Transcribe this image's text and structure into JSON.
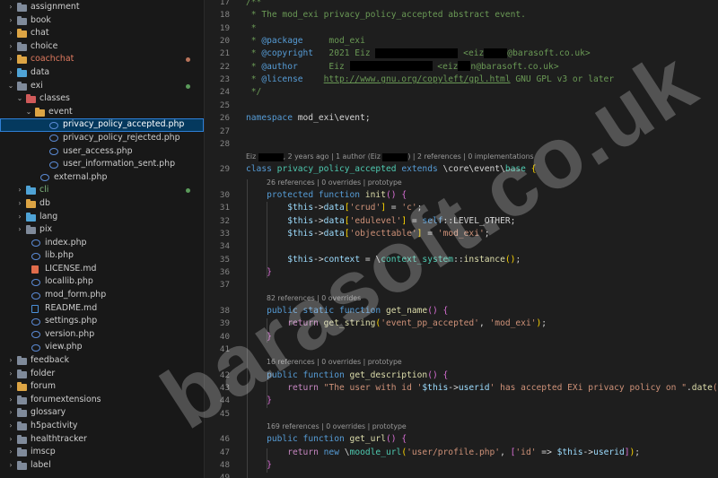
{
  "explorer": {
    "rows": [
      {
        "label": "assignment",
        "type": "folder",
        "chev": "›",
        "folder_color": "#7f8a9a"
      },
      {
        "label": "book",
        "type": "folder",
        "chev": "›",
        "folder_color": "#7f8a9a"
      },
      {
        "label": "chat",
        "type": "folder",
        "chev": "›",
        "folder_color": "#dca444"
      },
      {
        "label": "choice",
        "type": "folder",
        "chev": "›",
        "folder_color": "#7f8a9a"
      },
      {
        "label": "coachchat",
        "type": "folder",
        "chev": "›",
        "folder_color": "#dca444",
        "label_color": "#e07a5f",
        "dot": "#b8735a"
      },
      {
        "label": "data",
        "type": "folder",
        "chev": "›",
        "folder_color": "#4fa3d6"
      },
      {
        "label": "exi",
        "type": "folder",
        "chev": "⌄",
        "folder_color": "#7f8a9a",
        "dot": "#5a9a5a"
      },
      {
        "label": "classes",
        "type": "folder",
        "chev": "⌄",
        "folder_color": "#d05a5a"
      },
      {
        "label": "event",
        "type": "folder",
        "chev": "⌄",
        "folder_color": "#dca444"
      },
      {
        "label": "privacy_policy_accepted.php",
        "type": "php",
        "selected": true
      },
      {
        "label": "privacy_policy_rejected.php",
        "type": "php"
      },
      {
        "label": "user_access.php",
        "type": "php"
      },
      {
        "label": "user_information_sent.php",
        "type": "php"
      },
      {
        "label": "external.php",
        "type": "php"
      },
      {
        "label": "cli",
        "type": "folder",
        "chev": "›",
        "folder_color": "#4fa3d6",
        "label_color": "#7fb77e",
        "dot": "#5a9a5a"
      },
      {
        "label": "db",
        "type": "folder",
        "chev": "›",
        "folder_color": "#dca444"
      },
      {
        "label": "lang",
        "type": "folder",
        "chev": "›",
        "folder_color": "#4fa3d6"
      },
      {
        "label": "pix",
        "type": "folder",
        "chev": "›",
        "folder_color": "#7f8a9a"
      },
      {
        "label": "index.php",
        "type": "php"
      },
      {
        "label": "lib.php",
        "type": "php"
      },
      {
        "label": "LICENSE.md",
        "type": "lic"
      },
      {
        "label": "locallib.php",
        "type": "php"
      },
      {
        "label": "mod_form.php",
        "type": "php"
      },
      {
        "label": "README.md",
        "type": "md"
      },
      {
        "label": "settings.php",
        "type": "php"
      },
      {
        "label": "version.php",
        "type": "php"
      },
      {
        "label": "view.php",
        "type": "php"
      },
      {
        "label": "feedback",
        "type": "folder",
        "chev": "›",
        "folder_color": "#7f8a9a"
      },
      {
        "label": "folder",
        "type": "folder",
        "chev": "›",
        "folder_color": "#7f8a9a"
      },
      {
        "label": "forum",
        "type": "folder",
        "chev": "›",
        "folder_color": "#dca444"
      },
      {
        "label": "forumextensions",
        "type": "folder",
        "chev": "›",
        "folder_color": "#7f8a9a"
      },
      {
        "label": "glossary",
        "type": "folder",
        "chev": "›",
        "folder_color": "#7f8a9a"
      },
      {
        "label": "h5pactivity",
        "type": "folder",
        "chev": "›",
        "folder_color": "#7f8a9a"
      },
      {
        "label": "healthtracker",
        "type": "folder",
        "chev": "›",
        "folder_color": "#7f8a9a"
      },
      {
        "label": "imscp",
        "type": "folder",
        "chev": "›",
        "folder_color": "#7f8a9a"
      },
      {
        "label": "label",
        "type": "folder",
        "chev": "›",
        "folder_color": "#7f8a9a"
      }
    ]
  },
  "editor": {
    "lines": [
      {
        "n": "17",
        "segs": [
          {
            "t": "/**",
            "c": "c"
          }
        ]
      },
      {
        "n": "18",
        "segs": [
          {
            "t": " * The mod_exi privacy_policy_accepted abstract event.",
            "c": "c"
          }
        ]
      },
      {
        "n": "19",
        "segs": [
          {
            "t": " *",
            "c": "c"
          }
        ]
      },
      {
        "n": "20",
        "segs": [
          {
            "t": " * ",
            "c": "c"
          },
          {
            "t": "@package",
            "c": "k"
          },
          {
            "t": "     mod_exi",
            "c": "c"
          }
        ]
      },
      {
        "n": "21",
        "segs": [
          {
            "t": " * ",
            "c": "c"
          },
          {
            "t": "@copyright",
            "c": "k"
          },
          {
            "t": "   2021 Eiz ",
            "c": "c"
          },
          {
            "r": 92
          },
          {
            "t": " <eiz",
            "c": "c"
          },
          {
            "r": 26
          },
          {
            "t": "@barasoft.co.uk>",
            "c": "c"
          }
        ]
      },
      {
        "n": "22",
        "segs": [
          {
            "t": " * ",
            "c": "c"
          },
          {
            "t": "@author",
            "c": "k"
          },
          {
            "t": "      Eiz ",
            "c": "c"
          },
          {
            "r": 92
          },
          {
            "t": " <eiz",
            "c": "c"
          },
          {
            "r": 14
          },
          {
            "t": "n@barasoft.co.uk>",
            "c": "c"
          }
        ]
      },
      {
        "n": "23",
        "segs": [
          {
            "t": " * ",
            "c": "c"
          },
          {
            "t": "@license",
            "c": "k"
          },
          {
            "t": "    ",
            "c": "c"
          },
          {
            "t": "http://www.gnu.org/copyleft/gpl.html",
            "c": "u"
          },
          {
            "t": " GNU GPL v3 or later",
            "c": "c"
          }
        ]
      },
      {
        "n": "24",
        "segs": [
          {
            "t": " */",
            "c": "c"
          }
        ]
      },
      {
        "n": "25",
        "segs": []
      },
      {
        "n": "26",
        "segs": [
          {
            "t": "namespace",
            "c": "k"
          },
          {
            "t": " mod_exi\\event;",
            "c": "w"
          }
        ]
      },
      {
        "n": "27",
        "segs": []
      },
      {
        "n": "28",
        "segs": []
      },
      {
        "lens": [
          "Eiz ",
          {
            "r": 28
          },
          ", 2 years ago | 1 author (Eiz ",
          {
            "r": 28
          },
          ") | 2 references | 0 implementations"
        ],
        "indent": 0
      },
      {
        "n": "29",
        "segs": [
          {
            "t": "class",
            "c": "k"
          },
          {
            "t": " ",
            "c": "w"
          },
          {
            "t": "privacy_policy_accepted",
            "c": "t"
          },
          {
            "t": " ",
            "c": "w"
          },
          {
            "t": "extends",
            "c": "k"
          },
          {
            "t": " \\core\\event\\",
            "c": "w"
          },
          {
            "t": "base",
            "c": "t"
          },
          {
            "t": " ",
            "c": "w"
          },
          {
            "t": "{",
            "c": "p"
          }
        ]
      },
      {
        "lens": [
          "26 references | 0 overrides | prototype"
        ],
        "indent": 1
      },
      {
        "n": "30",
        "segs": [
          {
            "t": "    ",
            "c": "w"
          },
          {
            "t": "protected",
            "c": "k"
          },
          {
            "t": " ",
            "c": "w"
          },
          {
            "t": "function",
            "c": "k"
          },
          {
            "t": " ",
            "c": "w"
          },
          {
            "t": "init",
            "c": "f"
          },
          {
            "t": "()",
            "c": "m"
          },
          {
            "t": " ",
            "c": "w"
          },
          {
            "t": "{",
            "c": "m"
          }
        ]
      },
      {
        "n": "31",
        "segs": [
          {
            "t": "        ",
            "c": "w"
          },
          {
            "t": "$this",
            "c": "v"
          },
          {
            "t": "->",
            "c": "w"
          },
          {
            "t": "data",
            "c": "v"
          },
          {
            "t": "[",
            "c": "p"
          },
          {
            "t": "'crud'",
            "c": "s"
          },
          {
            "t": "]",
            "c": "p"
          },
          {
            "t": " = ",
            "c": "w"
          },
          {
            "t": "'c'",
            "c": "s"
          },
          {
            "t": ";",
            "c": "w"
          }
        ]
      },
      {
        "n": "32",
        "segs": [
          {
            "t": "        ",
            "c": "w"
          },
          {
            "t": "$this",
            "c": "v"
          },
          {
            "t": "->",
            "c": "w"
          },
          {
            "t": "data",
            "c": "v"
          },
          {
            "t": "[",
            "c": "p"
          },
          {
            "t": "'edulevel'",
            "c": "s"
          },
          {
            "t": "]",
            "c": "p"
          },
          {
            "t": " = ",
            "c": "w"
          },
          {
            "t": "self",
            "c": "k"
          },
          {
            "t": "::LEVEL_OTHER;",
            "c": "w"
          }
        ]
      },
      {
        "n": "33",
        "segs": [
          {
            "t": "        ",
            "c": "w"
          },
          {
            "t": "$this",
            "c": "v"
          },
          {
            "t": "->",
            "c": "w"
          },
          {
            "t": "data",
            "c": "v"
          },
          {
            "t": "[",
            "c": "p"
          },
          {
            "t": "'objecttable'",
            "c": "s"
          },
          {
            "t": "]",
            "c": "p"
          },
          {
            "t": " = ",
            "c": "w"
          },
          {
            "t": "'mod_exi'",
            "c": "s"
          },
          {
            "t": ";",
            "c": "w"
          }
        ]
      },
      {
        "n": "34",
        "segs": []
      },
      {
        "n": "35",
        "segs": [
          {
            "t": "        ",
            "c": "w"
          },
          {
            "t": "$this",
            "c": "v"
          },
          {
            "t": "->",
            "c": "w"
          },
          {
            "t": "context",
            "c": "v"
          },
          {
            "t": " = \\",
            "c": "w"
          },
          {
            "t": "context_system",
            "c": "t"
          },
          {
            "t": "::",
            "c": "w"
          },
          {
            "t": "instance",
            "c": "f"
          },
          {
            "t": "()",
            "c": "p"
          },
          {
            "t": ";",
            "c": "w"
          }
        ]
      },
      {
        "n": "36",
        "segs": [
          {
            "t": "    ",
            "c": "w"
          },
          {
            "t": "}",
            "c": "m"
          }
        ]
      },
      {
        "n": "37",
        "segs": []
      },
      {
        "lens": [
          "82 references | 0 overrides"
        ],
        "indent": 1
      },
      {
        "n": "38",
        "segs": [
          {
            "t": "    ",
            "c": "w"
          },
          {
            "t": "public",
            "c": "k"
          },
          {
            "t": " ",
            "c": "w"
          },
          {
            "t": "static",
            "c": "k"
          },
          {
            "t": " ",
            "c": "w"
          },
          {
            "t": "function",
            "c": "k"
          },
          {
            "t": " ",
            "c": "w"
          },
          {
            "t": "get_name",
            "c": "f"
          },
          {
            "t": "()",
            "c": "m"
          },
          {
            "t": " ",
            "c": "w"
          },
          {
            "t": "{",
            "c": "m"
          }
        ]
      },
      {
        "n": "39",
        "segs": [
          {
            "t": "        ",
            "c": "w"
          },
          {
            "t": "return",
            "c": "d"
          },
          {
            "t": " ",
            "c": "w"
          },
          {
            "t": "get_string",
            "c": "f"
          },
          {
            "t": "(",
            "c": "p"
          },
          {
            "t": "'event_pp_accepted'",
            "c": "s"
          },
          {
            "t": ", ",
            "c": "w"
          },
          {
            "t": "'mod_exi'",
            "c": "s"
          },
          {
            "t": ")",
            "c": "p"
          },
          {
            "t": ";",
            "c": "w"
          }
        ]
      },
      {
        "n": "40",
        "segs": [
          {
            "t": "    ",
            "c": "w"
          },
          {
            "t": "}",
            "c": "m"
          }
        ]
      },
      {
        "n": "41",
        "segs": []
      },
      {
        "lens": [
          "16 references | 0 overrides | prototype"
        ],
        "indent": 1
      },
      {
        "n": "42",
        "segs": [
          {
            "t": "    ",
            "c": "w"
          },
          {
            "t": "public",
            "c": "k"
          },
          {
            "t": " ",
            "c": "w"
          },
          {
            "t": "function",
            "c": "k"
          },
          {
            "t": " ",
            "c": "w"
          },
          {
            "t": "get_description",
            "c": "f"
          },
          {
            "t": "()",
            "c": "m"
          },
          {
            "t": " ",
            "c": "w"
          },
          {
            "t": "{",
            "c": "m"
          }
        ]
      },
      {
        "n": "43",
        "segs": [
          {
            "t": "        ",
            "c": "w"
          },
          {
            "t": "return",
            "c": "d"
          },
          {
            "t": " ",
            "c": "w"
          },
          {
            "t": "\"The user with id '",
            "c": "s"
          },
          {
            "t": "$this",
            "c": "v"
          },
          {
            "t": "->",
            "c": "w"
          },
          {
            "t": "userid",
            "c": "v"
          },
          {
            "t": "' has accepted EXi privacy policy on \"",
            "c": "s"
          },
          {
            "t": ".",
            "c": "w"
          },
          {
            "t": "date",
            "c": "f"
          },
          {
            "t": "('d/",
            "c": "s"
          }
        ]
      },
      {
        "n": "44",
        "segs": [
          {
            "t": "    ",
            "c": "w"
          },
          {
            "t": "}",
            "c": "m"
          }
        ]
      },
      {
        "n": "45",
        "segs": []
      },
      {
        "lens": [
          "169 references | 0 overrides | prototype"
        ],
        "indent": 1
      },
      {
        "n": "46",
        "segs": [
          {
            "t": "    ",
            "c": "w"
          },
          {
            "t": "public",
            "c": "k"
          },
          {
            "t": " ",
            "c": "w"
          },
          {
            "t": "function",
            "c": "k"
          },
          {
            "t": " ",
            "c": "w"
          },
          {
            "t": "get_url",
            "c": "f"
          },
          {
            "t": "()",
            "c": "m"
          },
          {
            "t": " ",
            "c": "w"
          },
          {
            "t": "{",
            "c": "m"
          }
        ]
      },
      {
        "n": "47",
        "segs": [
          {
            "t": "        ",
            "c": "w"
          },
          {
            "t": "return",
            "c": "d"
          },
          {
            "t": " ",
            "c": "w"
          },
          {
            "t": "new",
            "c": "k"
          },
          {
            "t": " \\",
            "c": "w"
          },
          {
            "t": "moodle_url",
            "c": "t"
          },
          {
            "t": "(",
            "c": "p"
          },
          {
            "t": "'user/profile.php'",
            "c": "s"
          },
          {
            "t": ", ",
            "c": "w"
          },
          {
            "t": "[",
            "c": "m"
          },
          {
            "t": "'id'",
            "c": "s"
          },
          {
            "t": " => ",
            "c": "w"
          },
          {
            "t": "$this",
            "c": "v"
          },
          {
            "t": "->",
            "c": "w"
          },
          {
            "t": "userid",
            "c": "v"
          },
          {
            "t": "]",
            "c": "m"
          },
          {
            "t": ")",
            "c": "p"
          },
          {
            "t": ";",
            "c": "w"
          }
        ]
      },
      {
        "n": "48",
        "segs": [
          {
            "t": "    ",
            "c": "w"
          },
          {
            "t": "}",
            "c": "m"
          }
        ]
      },
      {
        "n": "49",
        "segs": []
      }
    ]
  },
  "watermark": "barasoft.co.uk"
}
